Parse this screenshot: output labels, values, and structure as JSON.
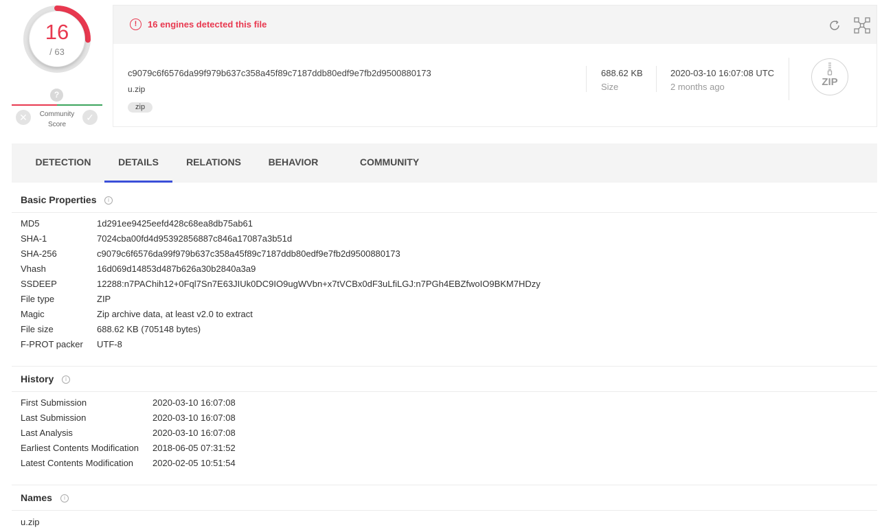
{
  "score": {
    "detected": "16",
    "total": "/ 63",
    "fraction_detected": 0.254
  },
  "community": {
    "label_line1": "Community",
    "label_line2": "Score",
    "help_glyph": "?"
  },
  "header": {
    "alert_text": "16 engines detected this file",
    "hash": "c9079c6f6576da99f979b637c358a45f89c7187ddb80edf9e7fb2d9500880173",
    "file_name": "u.zip",
    "tag": "zip",
    "size_value": "688.62 KB",
    "size_label": "Size",
    "date_value": "2020-03-10 16:07:08 UTC",
    "date_label": "2 months ago",
    "file_type_badge": "ZIP"
  },
  "tabs": [
    {
      "label": "DETECTION"
    },
    {
      "label": "DETAILS",
      "active": true
    },
    {
      "label": "RELATIONS"
    },
    {
      "label": "BEHAVIOR"
    },
    {
      "label": "COMMUNITY"
    }
  ],
  "basic_properties": {
    "title": "Basic Properties",
    "rows": [
      {
        "k": "MD5",
        "v": "1d291ee9425eefd428c68ea8db75ab61"
      },
      {
        "k": "SHA-1",
        "v": "7024cba00fd4d95392856887c846a17087a3b51d"
      },
      {
        "k": "SHA-256",
        "v": "c9079c6f6576da99f979b637c358a45f89c7187ddb80edf9e7fb2d9500880173"
      },
      {
        "k": "Vhash",
        "v": "16d069d14853d487b626a30b2840a3a9"
      },
      {
        "k": "SSDEEP",
        "v": "12288:n7PAChih12+0Fql7Sn7E63JIUk0DC9IO9ugWVbn+x7tVCBx0dF3uLfiLGJ:n7PGh4EBZfwoIO9BKM7HDzy"
      },
      {
        "k": "File type",
        "v": "ZIP"
      },
      {
        "k": "Magic",
        "v": "Zip archive data, at least v2.0 to extract"
      },
      {
        "k": "File size",
        "v": "688.62 KB (705148 bytes)"
      },
      {
        "k": "F-PROT packer",
        "v": "UTF-8"
      }
    ]
  },
  "history": {
    "title": "History",
    "rows": [
      {
        "k": "First Submission",
        "v": "2020-03-10 16:07:08"
      },
      {
        "k": "Last Submission",
        "v": "2020-03-10 16:07:08"
      },
      {
        "k": "Last Analysis",
        "v": "2020-03-10 16:07:08"
      },
      {
        "k": "Earliest Contents Modification",
        "v": "2018-06-05 07:31:52"
      },
      {
        "k": "Latest Contents Modification",
        "v": "2020-02-05 10:51:54"
      }
    ]
  },
  "names": {
    "title": "Names",
    "rows": [
      {
        "v": "u.zip"
      }
    ]
  },
  "colors": {
    "danger": "#e8384f",
    "accent": "#3b4fd8",
    "good": "#3ba45c"
  },
  "icons": [
    "alert-circle-icon",
    "refresh-icon",
    "graph-icon",
    "zip-file-icon",
    "info-icon",
    "close-icon",
    "check-icon",
    "question-icon"
  ]
}
